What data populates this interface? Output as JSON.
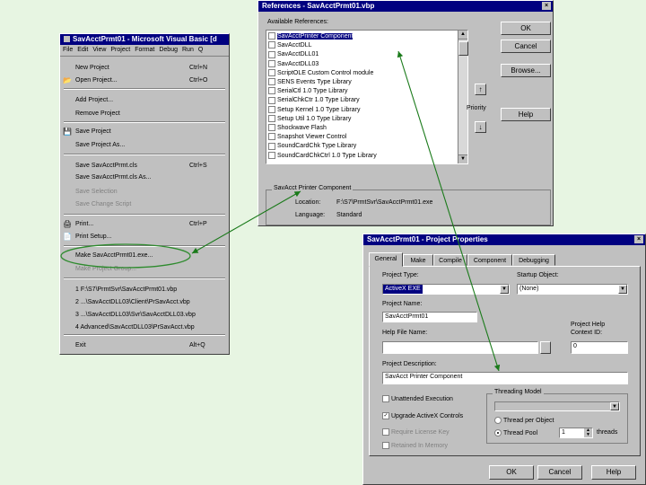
{
  "menu_window": {
    "title": "SavAcctPrmt01 - Microsoft Visual Basic [d",
    "menubar": [
      "File",
      "Edit",
      "View",
      "Project",
      "Format",
      "Debug",
      "Run",
      "Q"
    ],
    "items": [
      {
        "label": "New Project",
        "shortcut": "Ctrl+N",
        "icon": "",
        "disabled": false
      },
      {
        "label": "Open Project...",
        "shortcut": "Ctrl+O",
        "icon": "open-folder-icon",
        "disabled": false
      },
      {
        "label": "Add Project...",
        "shortcut": "",
        "icon": "",
        "disabled": false
      },
      {
        "label": "Remove Project",
        "shortcut": "",
        "icon": "",
        "disabled": false
      },
      {
        "label": "Save Project",
        "shortcut": "",
        "icon": "save-disk-icon",
        "disabled": false
      },
      {
        "label": "Save Project As...",
        "shortcut": "",
        "icon": "",
        "disabled": false
      },
      {
        "label": "Save SavAcctPrmt.cls",
        "shortcut": "Ctrl+S",
        "icon": "",
        "disabled": false
      },
      {
        "label": "Save SavAcctPrmt.cls As...",
        "shortcut": "",
        "icon": "",
        "disabled": false
      },
      {
        "label": "Save Selection",
        "shortcut": "",
        "icon": "",
        "disabled": true
      },
      {
        "label": "Save Change Script",
        "shortcut": "",
        "icon": "",
        "disabled": true
      },
      {
        "label": "Print...",
        "shortcut": "Ctrl+P",
        "icon": "printer-icon",
        "disabled": false
      },
      {
        "label": "Print Setup...",
        "shortcut": "",
        "icon": "print-setup-icon",
        "disabled": false
      },
      {
        "label": "Make SavAcctPrmt01.exe...",
        "shortcut": "",
        "icon": "",
        "disabled": false
      },
      {
        "label": "Make Project Group...",
        "shortcut": "",
        "icon": "",
        "disabled": true
      },
      {
        "label": "1 F:\\S7\\PrmtSvr\\SavAcctPrmt01.vbp",
        "shortcut": "",
        "icon": "",
        "disabled": false
      },
      {
        "label": "2 ...\\SavAcctDLL03\\Client\\PrSavAcct.vbp",
        "shortcut": "",
        "icon": "",
        "disabled": false
      },
      {
        "label": "3 ...\\SavAcctDLL03\\Svr\\SavAcctDLL03.vbp",
        "shortcut": "",
        "icon": "",
        "disabled": false
      },
      {
        "label": "4 Advanced\\SavAcctDLL03\\PrSavAcct.vbp",
        "shortcut": "",
        "icon": "",
        "disabled": false
      },
      {
        "label": "Exit",
        "shortcut": "Alt+Q",
        "icon": "",
        "disabled": false
      }
    ]
  },
  "references_window": {
    "title": "References - SavAcctPrmt01.vbp",
    "list_label": "Available References:",
    "items": [
      {
        "label": "SavAcctPrinter Component",
        "checked": false,
        "selected": true
      },
      {
        "label": "SavAcctDLL",
        "checked": false,
        "selected": false
      },
      {
        "label": "SavAcctDLL01",
        "checked": false,
        "selected": false
      },
      {
        "label": "SavAcctDLL03",
        "checked": false,
        "selected": false
      },
      {
        "label": "ScriptOLE Custom Control module",
        "checked": false,
        "selected": false
      },
      {
        "label": "SENS Events Type Library",
        "checked": false,
        "selected": false
      },
      {
        "label": "SerialCtl 1.0 Type Library",
        "checked": false,
        "selected": false
      },
      {
        "label": "SerialChkCtr 1.0 Type Library",
        "checked": false,
        "selected": false
      },
      {
        "label": "Setup Kernel 1.0 Type Library",
        "checked": false,
        "selected": false
      },
      {
        "label": "Setup Util 1.0 Type Library",
        "checked": false,
        "selected": false
      },
      {
        "label": "Shockwave Flash",
        "checked": false,
        "selected": false
      },
      {
        "label": "Snapshot Viewer Control",
        "checked": false,
        "selected": false
      },
      {
        "label": "SoundCardChk Type Library",
        "checked": false,
        "selected": false
      },
      {
        "label": "SoundCardChkCtrl 1.0 Type Library",
        "checked": false,
        "selected": false
      }
    ],
    "buttons": {
      "ok": "OK",
      "cancel": "Cancel",
      "browse": "Browse...",
      "help": "Help"
    },
    "priority_label": "Priority",
    "group_title": "SavAcct Printer Component",
    "location_label": "Location:",
    "location_value": "F:\\S7\\PrmtSvr\\SavAcctPrmt01.exe",
    "language_label": "Language:",
    "language_value": "Standard"
  },
  "properties_window": {
    "title": "SavAcctPrmt01 - Project Properties",
    "tabs": [
      "General",
      "Make",
      "Compile",
      "Component",
      "Debugging"
    ],
    "project_type_label": "Project Type:",
    "project_type_value": "ActiveX EXE",
    "startup_label": "Startup Object:",
    "startup_value": "(None)",
    "project_name_label": "Project Name:",
    "project_name_value": "SavAcctPrmt01",
    "help_file_label": "Help File Name:",
    "help_file_value": "",
    "help_context_label": "Project Help Context ID:",
    "help_context_value": "0",
    "description_label": "Project Description:",
    "description_value": "SavAcct Printer Component",
    "checks": [
      {
        "label": "Unattended Execution",
        "checked": false,
        "disabled": false
      },
      {
        "label": "Upgrade ActiveX Controls",
        "checked": true,
        "disabled": false
      },
      {
        "label": "Require License Key",
        "checked": false,
        "disabled": true
      },
      {
        "label": "Retained In Memory",
        "checked": false,
        "disabled": true
      }
    ],
    "threading_label": "Threading Model",
    "thread_per_object": "Thread per Object",
    "thread_pool": "Thread Pool",
    "thread_pool_count": "1",
    "threads_label": "threads",
    "buttons": {
      "ok": "OK",
      "cancel": "Cancel",
      "help": "Help"
    }
  },
  "colors": {
    "background": "#e7f5e2",
    "titlebar": "#000080",
    "arrow": "#1a7a1a",
    "highlight_ellipse": "#2e8b2e"
  }
}
